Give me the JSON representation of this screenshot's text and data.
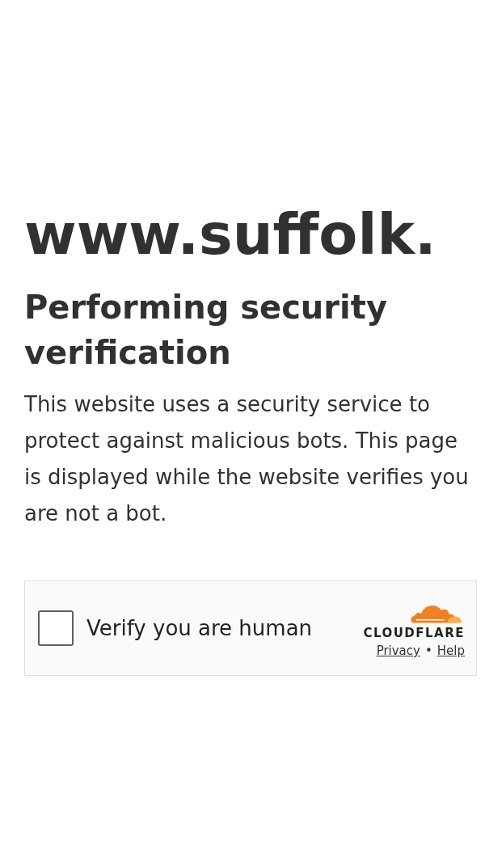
{
  "site": "www.suffolk.",
  "title": "Performing security verification",
  "message": "This website uses a security service to protect against malicious bots. This page is displayed while the website verifies you are not a bot.",
  "widget": {
    "checkbox": {
      "label": "Verify you are human",
      "checked": false
    },
    "brand": "CLOUDFLARE",
    "links": [
      {
        "text": "Privacy"
      },
      {
        "text": "Help"
      }
    ],
    "separator": "•"
  }
}
